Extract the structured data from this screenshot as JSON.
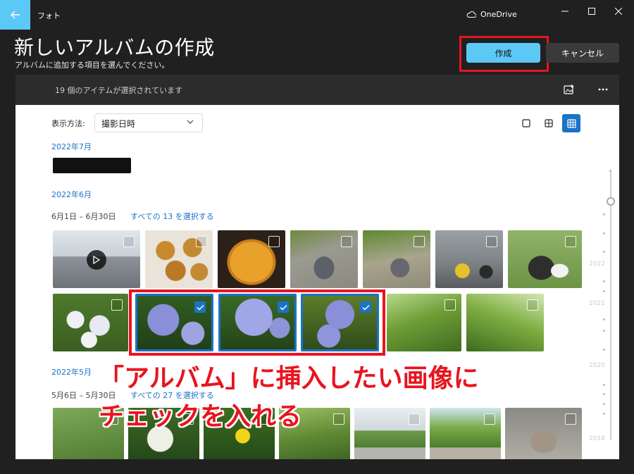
{
  "titlebar": {
    "app_name": "フォト",
    "onedrive_label": "OneDrive"
  },
  "header": {
    "title": "新しいアルバムの作成",
    "subtitle": "アルバムに追加する項目を選んでください。",
    "create_label": "作成",
    "cancel_label": "キャンセル"
  },
  "selection_bar": {
    "status": "19 個のアイテムが選択されています"
  },
  "sort": {
    "label": "表示方法:",
    "value": "撮影日時"
  },
  "groups": {
    "july": {
      "month": "2022年7月"
    },
    "june": {
      "month": "2022年6月",
      "range": "6月1日 – 6月30日",
      "select_all": "すべての 13 を選択する"
    },
    "may": {
      "month": "2022年5月",
      "range": "5月6日 – 5月30日",
      "select_all": "すべての 27 を選択する"
    }
  },
  "annotation": {
    "line1": "「アルバム」に挿入したい画像に",
    "line2": "チェックを入れる"
  },
  "timeline": {
    "years": [
      "2022",
      "2021",
      "2020",
      "2018"
    ]
  },
  "colors": {
    "accent": "#5cc8f5",
    "selection_blue": "#1a73c6",
    "annotation_red": "#e8141f"
  }
}
